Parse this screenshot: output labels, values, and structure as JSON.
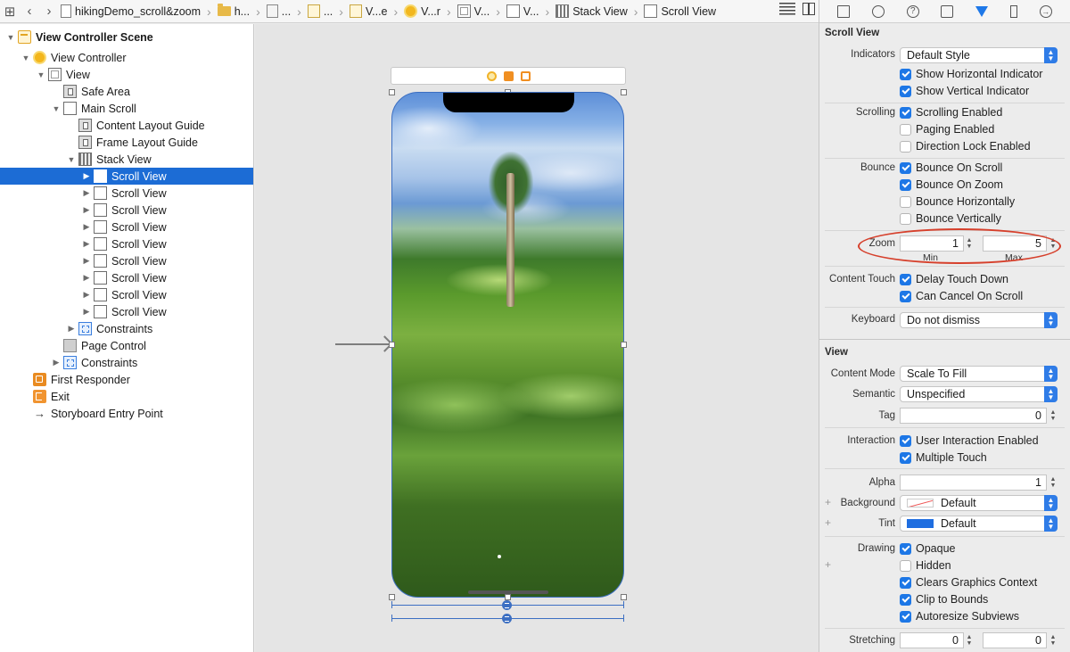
{
  "jumpbar": {
    "segments": [
      "hikingDemo_scroll&zoom",
      "h...",
      "...",
      "...",
      "V...e",
      "V...r",
      "V...",
      "V...",
      "Stack View",
      "Scroll View"
    ]
  },
  "outline": {
    "rows": [
      {
        "label": "View Controller Scene"
      },
      {
        "label": "View Controller"
      },
      {
        "label": "View"
      },
      {
        "label": "Safe Area"
      },
      {
        "label": "Main Scroll"
      },
      {
        "label": "Content Layout Guide"
      },
      {
        "label": "Frame Layout Guide"
      },
      {
        "label": "Stack View"
      },
      {
        "label": "Scroll View"
      },
      {
        "label": "Scroll View"
      },
      {
        "label": "Scroll View"
      },
      {
        "label": "Scroll View"
      },
      {
        "label": "Scroll View"
      },
      {
        "label": "Scroll View"
      },
      {
        "label": "Scroll View"
      },
      {
        "label": "Scroll View"
      },
      {
        "label": "Scroll View"
      },
      {
        "label": "Constraints"
      },
      {
        "label": "Page Control"
      },
      {
        "label": "Constraints"
      },
      {
        "label": "First Responder"
      },
      {
        "label": "Exit"
      },
      {
        "label": "Storyboard Entry Point"
      }
    ]
  },
  "inspector": {
    "scroll_view": {
      "title": "Scroll View",
      "indicators_label": "Indicators",
      "indicators_value": "Default Style",
      "show_horizontal": "Show Horizontal Indicator",
      "show_vertical": "Show Vertical Indicator",
      "scrolling_label": "Scrolling",
      "scrolling_enabled": "Scrolling Enabled",
      "paging_enabled": "Paging Enabled",
      "direction_lock": "Direction Lock Enabled",
      "bounce_label": "Bounce",
      "bounce_on_scroll": "Bounce On Scroll",
      "bounce_on_zoom": "Bounce On Zoom",
      "bounce_horizontally": "Bounce Horizontally",
      "bounce_vertically": "Bounce Vertically",
      "zoom_label": "Zoom",
      "zoom_min": "1",
      "zoom_max": "5",
      "min_label": "Min",
      "max_label": "Max",
      "content_touch_label": "Content Touch",
      "delay_touch_down": "Delay Touch Down",
      "can_cancel_on_scroll": "Can Cancel On Scroll",
      "keyboard_label": "Keyboard",
      "keyboard_value": "Do not dismiss"
    },
    "view": {
      "title": "View",
      "content_mode_label": "Content Mode",
      "content_mode_value": "Scale To Fill",
      "semantic_label": "Semantic",
      "semantic_value": "Unspecified",
      "tag_label": "Tag",
      "tag_value": "0",
      "interaction_label": "Interaction",
      "user_interaction_enabled": "User Interaction Enabled",
      "multiple_touch": "Multiple Touch",
      "alpha_label": "Alpha",
      "alpha_value": "1",
      "background_label": "Background",
      "background_value": "Default",
      "tint_label": "Tint",
      "tint_value": "Default",
      "drawing_label": "Drawing",
      "opaque": "Opaque",
      "hidden": "Hidden",
      "clears_graphics_context": "Clears Graphics Context",
      "clip_to_bounds": "Clip to Bounds",
      "autoresize_subviews": "Autoresize Subviews",
      "stretching_label": "Stretching",
      "stretching_x": "0",
      "stretching_y": "0"
    }
  },
  "colors": {
    "selection": "#1c6cd5",
    "accent": "#1d77e6",
    "highlight_ring": "#d6402c"
  }
}
